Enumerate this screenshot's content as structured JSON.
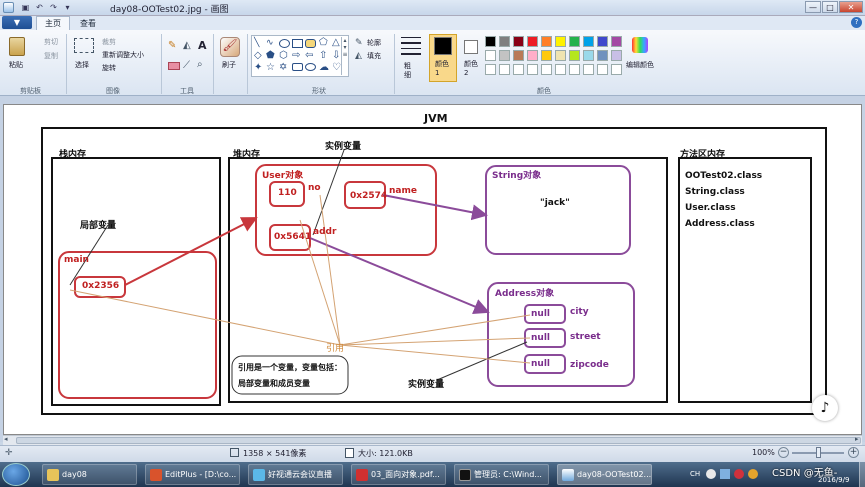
{
  "window": {
    "title": "day08-OOTest02.jpg - 画图",
    "minimize": "—",
    "maximize": "□",
    "close": "✕"
  },
  "quick_access": [
    "save-icon",
    "undo-icon",
    "redo-icon",
    "dropdown-icon"
  ],
  "menu_button": "▼",
  "tabs": [
    {
      "label": "主页"
    },
    {
      "label": "查看"
    }
  ],
  "ribbon": {
    "clipboard": {
      "paste": "粘贴",
      "cut": "剪切",
      "copy": "复制",
      "group": "剪贴板"
    },
    "image": {
      "select": "选择",
      "crop": "裁剪",
      "resize": "重新调整大小",
      "rotate": "旋转",
      "group": "图像"
    },
    "tools": {
      "group": "工具"
    },
    "brush": {
      "label": "刷子"
    },
    "shapes": {
      "outline": "轮廓",
      "fill": "填充",
      "group": "形状"
    },
    "size": {
      "label": "粗细"
    },
    "colors": {
      "color1": "颜色 1",
      "color2": "颜色 2",
      "edit": "编辑颜色",
      "group": "颜色"
    },
    "palette": [
      "#000000",
      "#7f7f7f",
      "#880015",
      "#ed1c24",
      "#ff7f27",
      "#fff200",
      "#22b14c",
      "#00a2e8",
      "#3f48cc",
      "#a349a4",
      "#ffffff",
      "#c3c3c3",
      "#b97a57",
      "#ffaec9",
      "#ffc90e",
      "#efe4b0",
      "#b5e61d",
      "#99d9ea",
      "#7092be",
      "#c8bfe7"
    ]
  },
  "diagram": {
    "title": "JVM",
    "stack": {
      "title": "栈内存",
      "local_var": "局部变量",
      "main": "main",
      "ref": "0x2356"
    },
    "heap": {
      "title": "堆内存",
      "instance_var_top": "实例变量",
      "user_obj": "User对象",
      "no_val": "110",
      "no_label": "no",
      "name_val": "0x2574",
      "name_label": "name",
      "addr_val": "0x5641",
      "addr_label": "addr",
      "string_obj": "String对象",
      "string_val": "\"jack\"",
      "address_obj": "Address对象",
      "fields": [
        {
          "val": "null",
          "label": "city"
        },
        {
          "val": "null",
          "label": "street"
        },
        {
          "val": "null",
          "label": "zipcode"
        }
      ],
      "reference": "引用",
      "note_line1": "引用是一个变量，变量包括：",
      "note_line2": "局部变量和成员变量",
      "instance_var_bottom": "实例变量"
    },
    "method_area": {
      "title": "方法区内存",
      "classes": [
        "OOTest02.class",
        "String.class",
        "User.class",
        "Address.class"
      ]
    }
  },
  "status": {
    "dimensions": "1358 × 541像素",
    "size": "大小: 121.0KB",
    "zoom": "100%"
  },
  "taskbar": {
    "items": [
      {
        "label": "day08"
      },
      {
        "label": "EditPlus - [D:\\co..."
      },
      {
        "label": "好视通云会议直播"
      },
      {
        "label": "03_面向对象.pdf..."
      },
      {
        "label": "管理员: C:\\Wind..."
      },
      {
        "label": "day08-OOTest02..."
      }
    ],
    "lang": "CH",
    "clock_time": "",
    "clock_date": "2016/9/9",
    "watermark": "CSDN @无鱼-"
  }
}
